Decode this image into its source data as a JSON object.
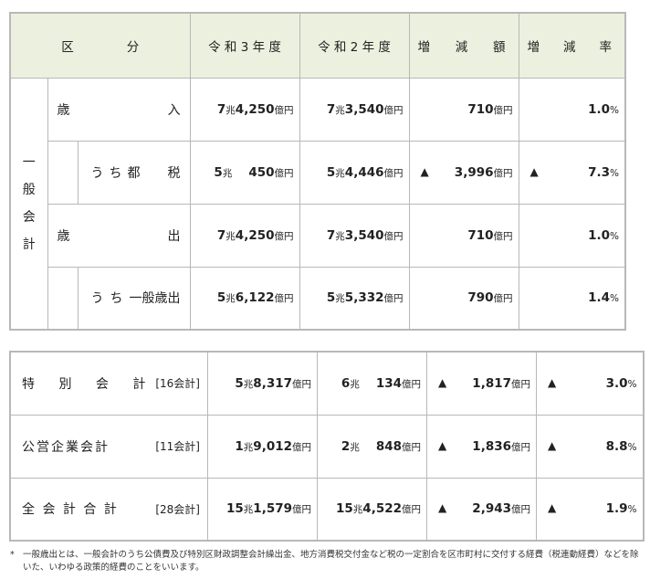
{
  "header": {
    "kubun_left": "区",
    "kubun_right": "分",
    "year3": "令 和 3 年 度",
    "year2": "令 和 2 年 度",
    "diff": [
      "増",
      "減",
      "額"
    ],
    "rate": [
      "増",
      "減",
      "率"
    ]
  },
  "general_account": {
    "vertical_label": [
      "一",
      "般",
      "会",
      "計"
    ],
    "rows": [
      {
        "label_left": "歳",
        "label_right": "入",
        "r3": {
          "cho": "7",
          "oku": "4,250"
        },
        "r2": {
          "cho": "7",
          "oku": "3,540"
        },
        "diff": {
          "sign": "",
          "value": "710"
        },
        "rate": {
          "sign": "",
          "value": "1.0"
        }
      },
      {
        "label_parts": [
          "う",
          "ち",
          "都",
          "税"
        ],
        "r3": {
          "cho": "5",
          "oku": "450"
        },
        "r2": {
          "cho": "5",
          "oku": "4,446"
        },
        "diff": {
          "sign": "▲",
          "value": "3,996"
        },
        "rate": {
          "sign": "▲",
          "value": "7.3"
        }
      },
      {
        "label_left": "歳",
        "label_right": "出",
        "r3": {
          "cho": "7",
          "oku": "4,250"
        },
        "r2": {
          "cho": "7",
          "oku": "3,540"
        },
        "diff": {
          "sign": "",
          "value": "710"
        },
        "rate": {
          "sign": "",
          "value": "1.0"
        }
      },
      {
        "label_parts": [
          "う",
          "ち",
          "一般歳出"
        ],
        "r3": {
          "cho": "5",
          "oku": "6,122"
        },
        "r2": {
          "cho": "5",
          "oku": "5,332"
        },
        "diff": {
          "sign": "",
          "value": "790"
        },
        "rate": {
          "sign": "",
          "value": "1.4"
        }
      }
    ]
  },
  "other_accounts": [
    {
      "label": "特 別 会 計",
      "count": "[16会計]",
      "r3": {
        "cho": "5",
        "oku": "8,317"
      },
      "r2": {
        "cho": "6",
        "oku": "134"
      },
      "diff": {
        "sign": "▲",
        "value": "1,817"
      },
      "rate": {
        "sign": "▲",
        "value": "3.0"
      }
    },
    {
      "label": "公営企業会計",
      "count": "[11会計]",
      "r3": {
        "cho": "1",
        "oku": "9,012"
      },
      "r2": {
        "cho": "2",
        "oku": "848"
      },
      "diff": {
        "sign": "▲",
        "value": "1,836"
      },
      "rate": {
        "sign": "▲",
        "value": "8.8"
      }
    },
    {
      "label": "全 会 計 合 計",
      "count": "[28会計]",
      "r3": {
        "cho": "15",
        "oku": "1,579"
      },
      "r2": {
        "cho": "15",
        "oku": "4,522"
      },
      "diff": {
        "sign": "▲",
        "value": "2,943"
      },
      "rate": {
        "sign": "▲",
        "value": "1.9"
      }
    }
  ],
  "units": {
    "cho": "兆",
    "oku": "億円",
    "percent": "%"
  },
  "footnote": {
    "mark": "*",
    "text": "一般歳出とは、一般会計のうち公債費及び特別区財政調整会計繰出金、地方消費税交付金など税の一定割合を区市町村に交付する経費（税連動経費）などを除いた、いわゆる政策的経費のことをいいます。"
  },
  "colors": {
    "header_bg": "#ebf1de",
    "border": "#b8b8b8"
  }
}
